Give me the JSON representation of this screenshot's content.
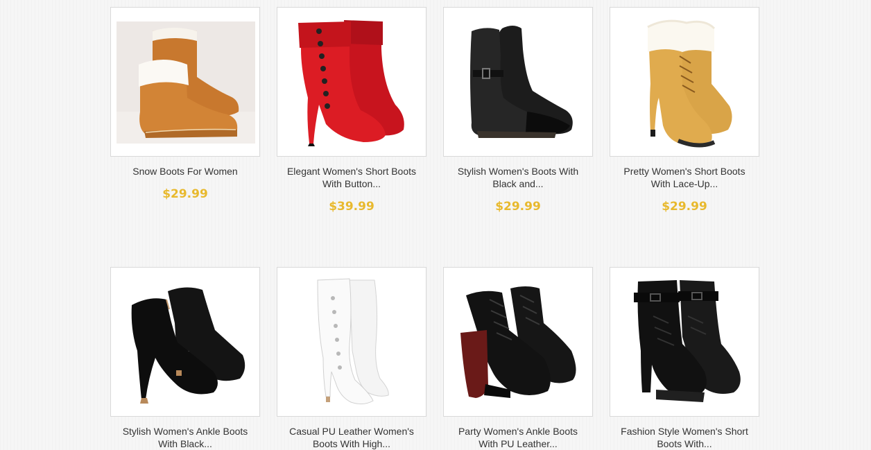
{
  "colors": {
    "price": "#e8b92e",
    "border": "#d9d9d9",
    "background": "#f6f6f6"
  },
  "products": [
    {
      "name": "Snow Boots For Women",
      "price": "$29.99",
      "image_icon": "snow-boots-image"
    },
    {
      "name": "Elegant Women's Short Boots With Button...",
      "price": "$39.99",
      "image_icon": "red-button-boots-image"
    },
    {
      "name": "Stylish Women's Boots With Black and...",
      "price": "$29.99",
      "image_icon": "black-buckle-boots-image"
    },
    {
      "name": "Pretty Women's Short Boots With Lace-Up...",
      "price": "$29.99",
      "image_icon": "tan-lace-up-boots-image"
    },
    {
      "name": "Stylish Women's Ankle Boots With Black...",
      "price": "",
      "image_icon": "black-suede-ankle-boots-image"
    },
    {
      "name": "Casual PU Leather Women's Boots With High...",
      "price": "",
      "image_icon": "white-tall-boots-image"
    },
    {
      "name": "Party Women's Ankle Boots With PU Leather...",
      "price": "",
      "image_icon": "black-lace-up-ankle-boots-image"
    },
    {
      "name": "Fashion Style Women's Short Boots With...",
      "price": "",
      "image_icon": "black-strap-boots-image"
    }
  ]
}
